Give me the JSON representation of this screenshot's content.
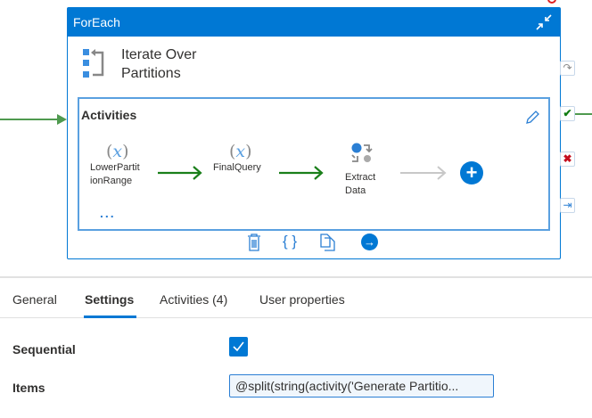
{
  "foreach": {
    "header": "ForEach",
    "title_line1": "Iterate Over",
    "title_line2": "Partitions",
    "activities_label": "Activities",
    "nodes": [
      {
        "label1": "LowerPartit",
        "label2": "ionRange",
        "icon": "variable-icon"
      },
      {
        "label1": "FinalQuery",
        "label2": "",
        "icon": "variable-icon"
      },
      {
        "label1": "Extract",
        "label2": "Data",
        "icon": "copy-data-icon"
      }
    ],
    "more": "...",
    "variable_glyph": "x"
  },
  "tabs": [
    {
      "label": "General"
    },
    {
      "label": "Settings",
      "active": true
    },
    {
      "label": "Activities (4)"
    },
    {
      "label": "User properties"
    }
  ],
  "settings": {
    "sequential_label": "Sequential",
    "sequential_checked": true,
    "items_label": "Items",
    "items_value": "@split(string(activity('Generate Partitio..."
  },
  "colors": {
    "accent": "#0078d4",
    "success": "#107c10",
    "fail": "#c50f1f"
  }
}
